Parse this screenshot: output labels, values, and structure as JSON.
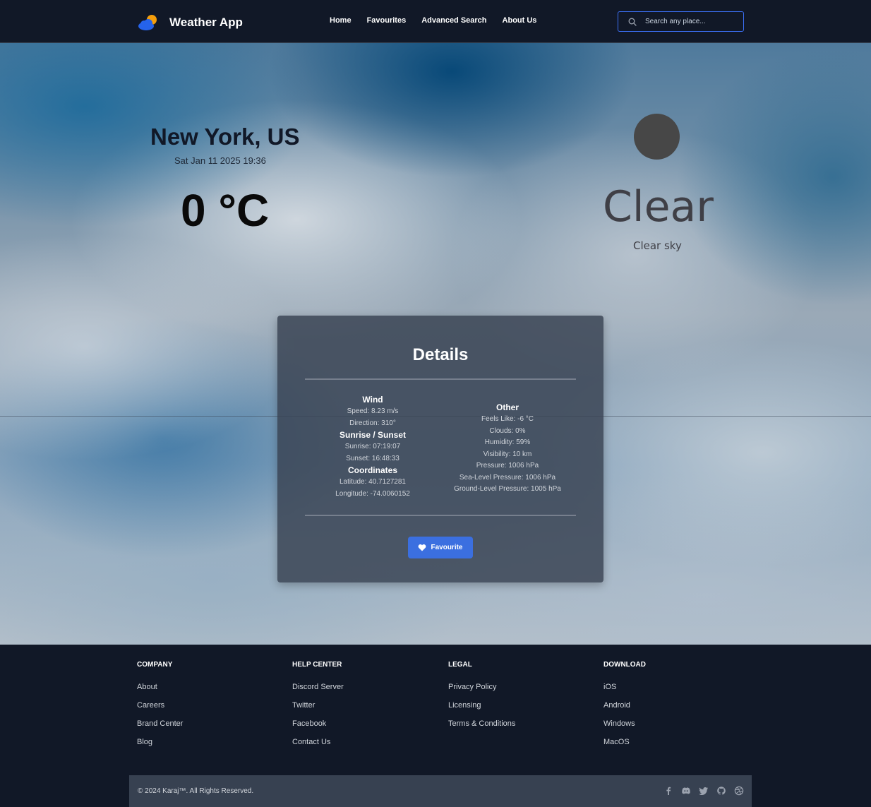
{
  "navbar": {
    "brand": "Weather App",
    "links": [
      "Home",
      "Favourites",
      "Advanced Search",
      "About Us"
    ],
    "search_placeholder": "Search any place..."
  },
  "weather": {
    "location": "New York, US",
    "datetime": "Sat Jan 11 2025 19:36",
    "temperature": "0 °C",
    "condition": "Clear",
    "description": "Clear sky"
  },
  "details": {
    "title": "Details",
    "wind": {
      "title": "Wind",
      "speed": "Speed: 8.23 m/s",
      "direction": "Direction: 310°"
    },
    "sun": {
      "title": "Sunrise / Sunset",
      "sunrise": "Sunrise: 07:19:07",
      "sunset": "Sunset: 16:48:33"
    },
    "coordinates": {
      "title": "Coordinates",
      "latitude": "Latitude: 40.7127281",
      "longitude": "Longitude: -74.0060152"
    },
    "other": {
      "title": "Other",
      "feels_like": "Feels Like: -6 °C",
      "clouds": "Clouds: 0%",
      "humidity": "Humidity: 59%",
      "visibility": "Visibility: 10 km",
      "pressure": "Pressure: 1006 hPa",
      "sea_level": "Sea-Level Pressure: 1006 hPa",
      "ground_level": "Ground-Level Pressure: 1005 hPa"
    },
    "favourite_label": "Favourite"
  },
  "footer": {
    "columns": [
      {
        "title": "COMPANY",
        "items": [
          "About",
          "Careers",
          "Brand Center",
          "Blog"
        ]
      },
      {
        "title": "HELP CENTER",
        "items": [
          "Discord Server",
          "Twitter",
          "Facebook",
          "Contact Us"
        ]
      },
      {
        "title": "LEGAL",
        "items": [
          "Privacy Policy",
          "Licensing",
          "Terms & Conditions"
        ]
      },
      {
        "title": "DOWNLOAD",
        "items": [
          "iOS",
          "Android",
          "Windows",
          "MacOS"
        ]
      }
    ],
    "copyright": "© 2024 Karaj™. All Rights Reserved.",
    "social_icons": [
      "facebook-icon",
      "discord-icon",
      "twitter-icon",
      "github-icon",
      "dribbble-icon"
    ]
  },
  "colors": {
    "navbar_bg": "#111827",
    "accent": "#3b6fe0",
    "card_bg": "#374151",
    "footer_bar_bg": "#374151"
  }
}
